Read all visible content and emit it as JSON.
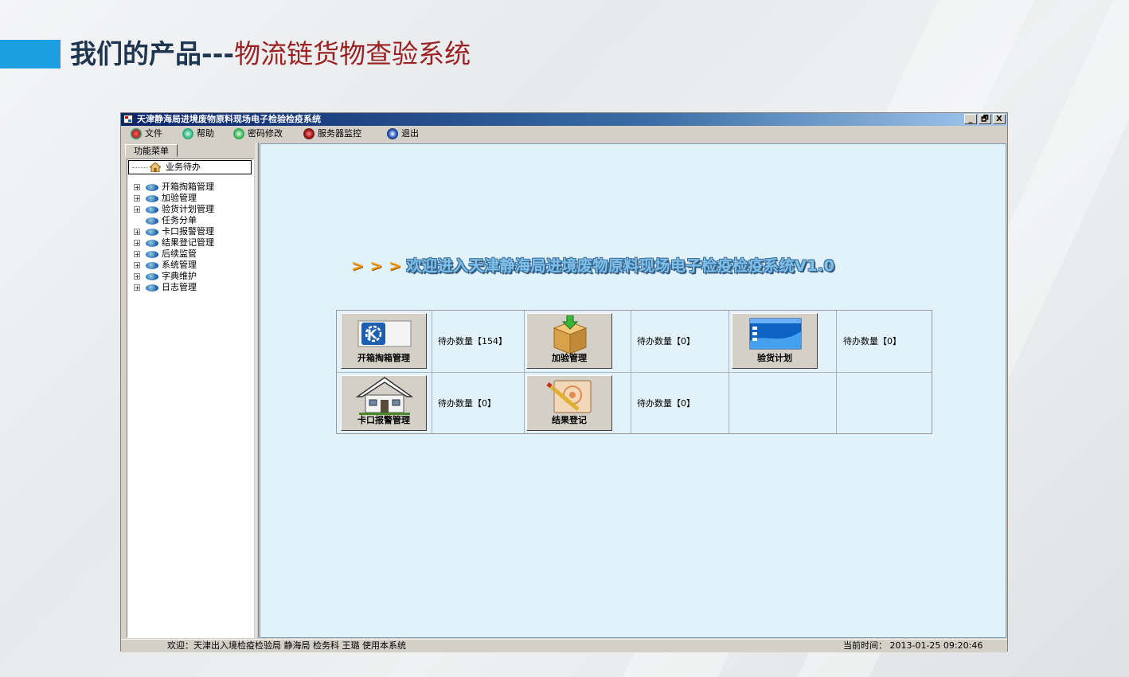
{
  "slide": {
    "title_bold": "我们的产品---",
    "title_rest": "物流链货物查验系统"
  },
  "window": {
    "title": "天津静海局进境废物原料现场电子检验检疫系统",
    "controls": [
      "_",
      "🗗",
      "X"
    ]
  },
  "menubar": {
    "items": [
      {
        "label": "文件",
        "icon": "file-icon"
      },
      {
        "label": "帮助",
        "icon": "help-icon"
      },
      {
        "label": "密码修改",
        "icon": "password-icon"
      },
      {
        "label": "服务器监控",
        "icon": "server-monitor-icon"
      },
      {
        "label": "退出",
        "icon": "exit-icon"
      }
    ]
  },
  "sidebar": {
    "tab": "功能菜单",
    "root": "业务待办",
    "items": [
      {
        "label": "开箱掏箱管理",
        "expandable": true
      },
      {
        "label": "加验管理",
        "expandable": true
      },
      {
        "label": "验货计划管理",
        "expandable": true
      },
      {
        "label": "任务分单",
        "expandable": false
      },
      {
        "label": "卡口报警管理",
        "expandable": true
      },
      {
        "label": "结果登记管理",
        "expandable": true
      },
      {
        "label": "后续监管",
        "expandable": true
      },
      {
        "label": "系统管理",
        "expandable": true
      },
      {
        "label": "字典维护",
        "expandable": true
      },
      {
        "label": "日志管理",
        "expandable": true
      }
    ]
  },
  "main": {
    "welcome_arrows": "> > >",
    "welcome": "欢迎进入天津静海局进境废物原料现场电子检疫检疫系统V1.0",
    "tiles": [
      {
        "label": "开箱掏箱管理",
        "count": "待办数量【154】",
        "icon": "kde-logo-icon"
      },
      {
        "label": "加验管理",
        "count": "待办数量【0】",
        "icon": "box-download-icon"
      },
      {
        "label": "验货计划",
        "count": "待办数量【0】",
        "icon": "window-panel-icon"
      },
      {
        "label": "卡口报警管理",
        "count": "待办数量【0】",
        "icon": "house-icon"
      },
      {
        "label": "结果登记",
        "count": "待办数量【0】",
        "icon": "notebook-pencil-icon"
      }
    ]
  },
  "statusbar": {
    "left": "欢迎：天津出入境检疫检验局 静海局 检务科 王璐 使用本系统",
    "right": "当前时间： 2013-01-25 09:20:46"
  }
}
